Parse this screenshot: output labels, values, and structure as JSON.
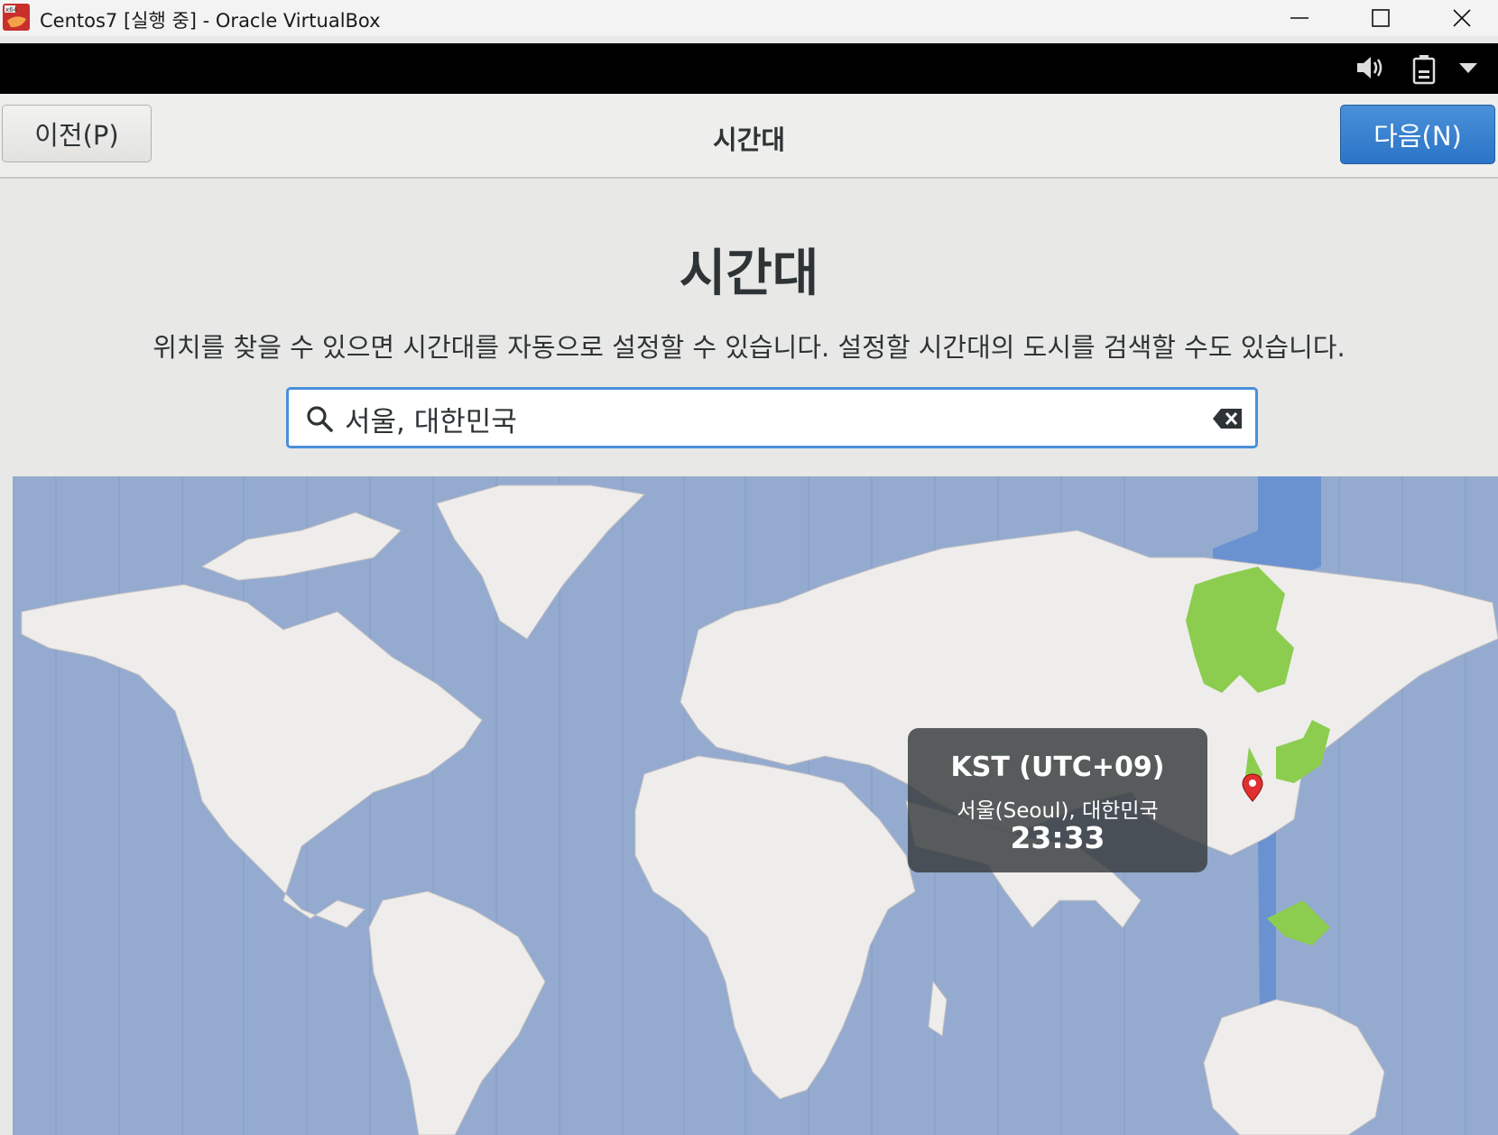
{
  "window": {
    "title": "Centos7 [실행 중] - Oracle VirtualBox",
    "app_icon": "virtualbox-icon",
    "controls": [
      "minimize-icon",
      "maximize-icon",
      "close-icon"
    ]
  },
  "vm_bar": {
    "icons": [
      "volume-icon",
      "battery-icon",
      "dropdown-arrow-icon"
    ]
  },
  "header": {
    "prev_label": "이전(P)",
    "title": "시간대",
    "next_label": "다음(N)"
  },
  "page": {
    "heading": "시간대",
    "description": "위치를 찾을 수 있으면 시간대를 자동으로 설정할 수 있습니다. 설정할 시간대의 도시를 검색할 수도 있습니다."
  },
  "search": {
    "value": "서울, 대한민국",
    "icon": "search-icon",
    "clear_icon": "clear-icon"
  },
  "timezone_popup": {
    "abbr": "KST (UTC+09)",
    "city": "서울(Seoul), 대한민국",
    "time": "23:33"
  },
  "colors": {
    "accent": "#4a90d9",
    "ocean": "#94abcf",
    "land": "#efedec",
    "selected_zone": "#6b92d0",
    "highlight_land": "#8ccd50",
    "marker": "#e03030"
  }
}
